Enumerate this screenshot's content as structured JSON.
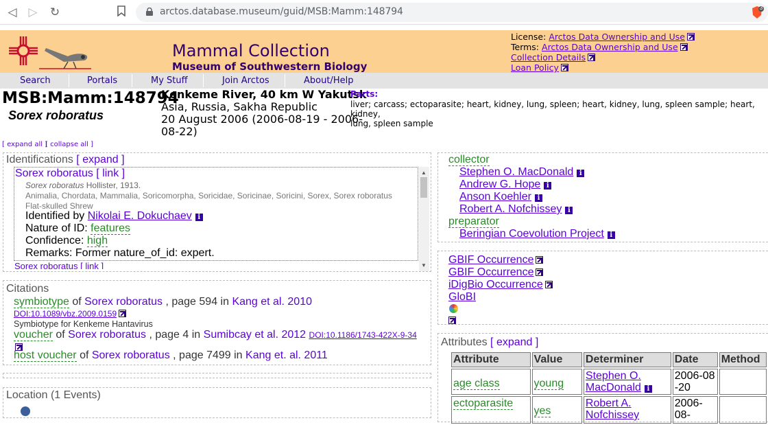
{
  "browser": {
    "url": "arctos.database.museum/guid/MSB:Mamm:148794",
    "brave_badge": "3"
  },
  "header": {
    "title": "Mammal Collection",
    "subtitle": "Museum of Southwestern Biology",
    "license_label": "License:",
    "license_link": "Arctos Data Ownership and Use",
    "terms_label": "Terms:",
    "terms_link": "Arctos Data Ownership and Use",
    "collection_details": "Collection Details",
    "loan_policy": "Loan Policy",
    "colors": {
      "banner": "#fcd090",
      "title": "#32006e"
    }
  },
  "menu": [
    "Search",
    "Portals",
    "My Stuff",
    "Join Arctos",
    "About/Help"
  ],
  "record": {
    "catnum": "MSB:Mamm:148794",
    "sciname": "Sorex roboratus",
    "locality": "Kenkeme River, 40 km W Yakutsk",
    "geography": "Asia, Russia, Sakha Republic",
    "date_line1": "20 August 2006 (2006-08-19 - 2006-",
    "date_line2": "08-22)",
    "parts_label": "Parts:",
    "parts_line1": "liver; carcass; ectoparasite; heart, kidney, lung, spleen; heart, kidney, lung, spleen sample; heart, kidney,",
    "parts_line2": "lung, spleen sample"
  },
  "controls": {
    "expand_all": "[ expand all ]",
    "collapse_all": "[ collapse all ]"
  },
  "identifications": {
    "heading": "Identifications",
    "expand": "[ expand ]",
    "name": "Sorex roboratus",
    "link": "[ link ]",
    "authority_name": "Sorex roboratus",
    "authority": "Hollister, 1913.",
    "taxonomy": "Animalia, Chordata, Mammalia, Soricomorpha, Soricidae, Soricinae, Soricini, Sorex, Sorex roboratus",
    "common": "Flat-skulled Shrew",
    "identified_by_label": "Identified by",
    "identified_by": "Nikolai E. Dokuchaev",
    "nature_label": "Nature of ID:",
    "nature": "features",
    "confidence_label": "Confidence:",
    "confidence": "high",
    "remarks": "Remarks: Former nature_of_id: expert.",
    "next_name": "Sorex roboratus [ link ]"
  },
  "citations": {
    "heading": "Citations",
    "items": [
      {
        "type": "symbiotype",
        "of": "of",
        "taxon": "Sorex roboratus",
        "page": ", page 594 in",
        "pub": "Kang et al. 2010",
        "doi": "DOI:10.1089/vbz.2009.0159",
        "note": "Symbiotype for Kenkeme Hantavirus"
      },
      {
        "type": "voucher",
        "of": "of",
        "taxon": "Sorex roboratus",
        "page": ", page 4 in",
        "pub": "Sumibcay et al. 2012",
        "doi": "DOI:10.1186/1743-422X-9-34"
      },
      {
        "type": "host voucher",
        "of": "of",
        "taxon": "Sorex roboratus",
        "page": ", page 7499 in",
        "pub": "Kang et. al. 2011"
      }
    ]
  },
  "location": {
    "heading": "Location (1 Events)"
  },
  "agents": {
    "collector_label": "collector",
    "collectors": [
      "Stephen O. MacDonald",
      "Andrew G. Hope",
      "Anson Koehler",
      "Robert A. Nofchissey"
    ],
    "preparator_label": "preparator",
    "preparators": [
      "Beringian Coevolution Project"
    ]
  },
  "links": [
    "GBIF Occurrence",
    "GBIF Occurrence",
    "iDigBio Occurrence",
    "GloBI"
  ],
  "attributes": {
    "heading": "Attributes",
    "expand": "[ expand ]",
    "columns": [
      "Attribute",
      "Value",
      "Determiner",
      "Date",
      "Method"
    ],
    "rows": [
      {
        "attribute": "age class",
        "value": "young",
        "determiner": "Stephen O. MacDonald",
        "date": "2006-08-20"
      },
      {
        "attribute": "ectoparasite",
        "value": "yes",
        "determiner": "Robert A. Nofchissey",
        "date": "2006-08-"
      }
    ]
  }
}
